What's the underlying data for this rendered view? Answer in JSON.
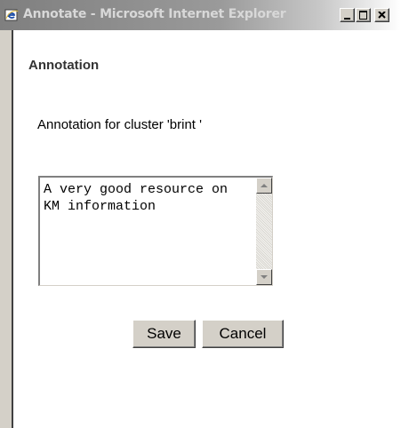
{
  "window": {
    "title": "Annotate - Microsoft Internet Explorer",
    "icon": "ie-icon",
    "controls": [
      "minimize-icon",
      "maximize-icon",
      "close-icon"
    ]
  },
  "page": {
    "heading": "Annotation",
    "prompt": "Annotation for cluster 'brint '",
    "textarea": {
      "value": "A very good resource on KM information"
    },
    "buttons": {
      "save_label": "Save",
      "cancel_label": "Cancel"
    }
  }
}
